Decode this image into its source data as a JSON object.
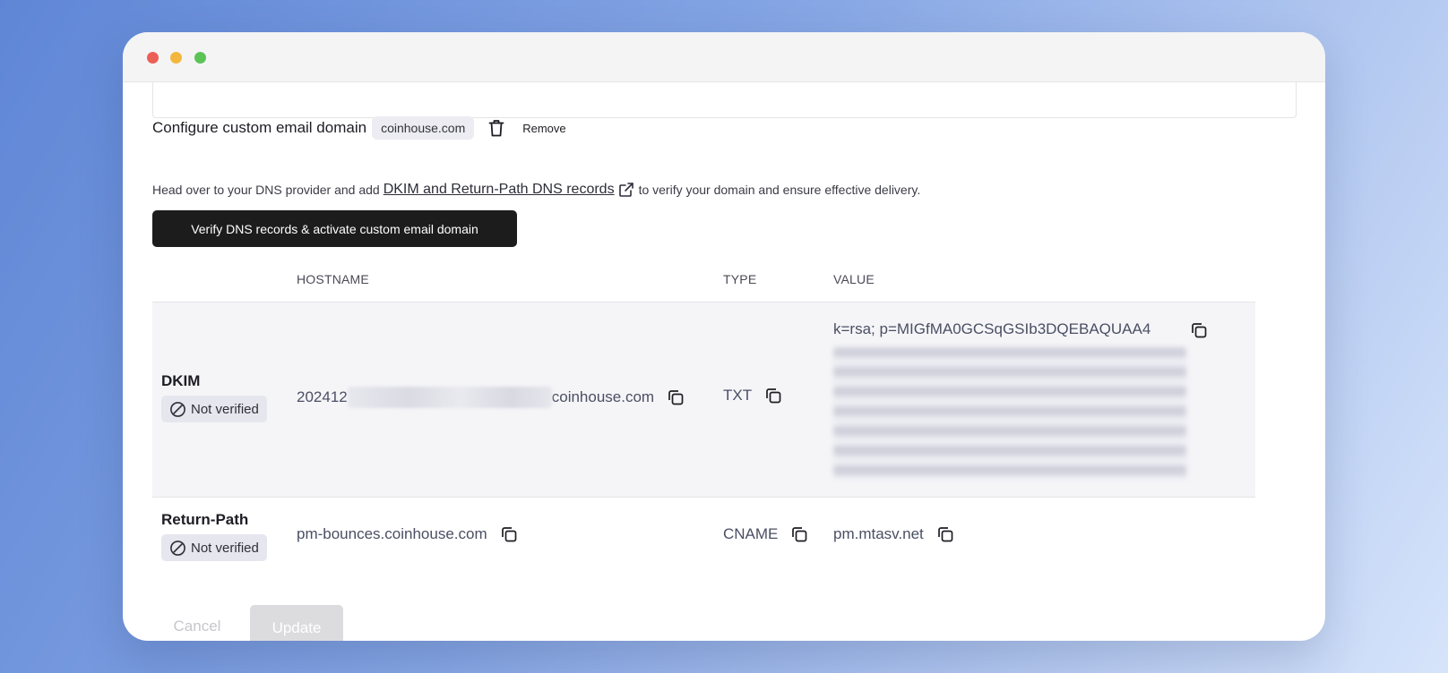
{
  "window": {
    "controls": [
      "close",
      "minimize",
      "maximize"
    ]
  },
  "config": {
    "heading": "Configure custom email domain",
    "domain": "coinhouse.com",
    "remove_label": "Remove",
    "desc_before": "Head over to your DNS provider and add",
    "desc_link": "DKIM and Return-Path DNS records",
    "desc_after": "to verify your domain and ensure effective delivery.",
    "verify_button": "Verify DNS records & activate custom email domain"
  },
  "table": {
    "headers": {
      "hostname": "HOSTNAME",
      "type": "TYPE",
      "value": "VALUE"
    },
    "rows": {
      "dkim": {
        "label": "DKIM",
        "status": "Not verified",
        "hostname_prefix": "202412",
        "hostname_suffix": "coinhouse.com",
        "type": "TXT",
        "value_visible": "k=rsa; p=MIGfMA0GCSqGSIb3DQEBAQUAA4"
      },
      "return_path": {
        "label": "Return-Path",
        "status": "Not verified",
        "hostname": "pm-bounces.coinhouse.com",
        "type": "CNAME",
        "value": "pm.mtasv.net"
      }
    }
  },
  "actions": {
    "cancel": "Cancel",
    "update": "Update"
  },
  "colors": {
    "primary_button": "#1c1c1c",
    "badge_bg": "#e6e6ee",
    "dkim_row_bg": "#f5f5f8",
    "disabled_button": "#dcdcdf"
  }
}
